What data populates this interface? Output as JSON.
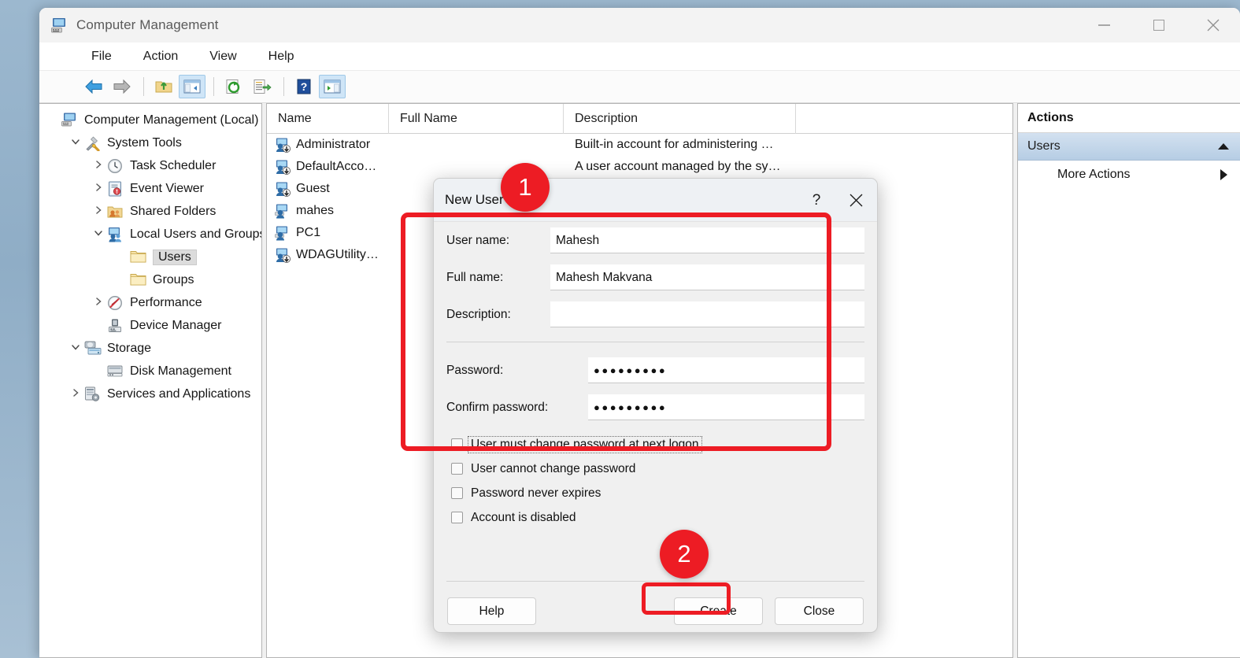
{
  "window": {
    "title": "Computer Management",
    "icon": "computer-management-icon",
    "controls": {
      "minimize": "–",
      "maximize": "□",
      "close": "✕"
    }
  },
  "menubar": {
    "items": [
      "File",
      "Action",
      "View",
      "Help"
    ]
  },
  "toolbar": {
    "buttons": [
      {
        "name": "back-icon",
        "label": "Back"
      },
      {
        "name": "forward-icon",
        "label": "Forward"
      },
      {
        "name": "up-one-level-icon",
        "label": "Up One Level"
      },
      {
        "name": "show-hide-console-tree-icon",
        "label": "Show/Hide Console Tree"
      },
      {
        "name": "refresh-icon",
        "label": "Refresh"
      },
      {
        "name": "export-list-icon",
        "label": "Export List"
      },
      {
        "name": "help-icon",
        "label": "Help"
      },
      {
        "name": "show-hide-action-pane-icon",
        "label": "Show/Hide Action Pane"
      }
    ]
  },
  "tree": {
    "nodes": [
      {
        "label": "Computer Management (Local)",
        "indent": 0,
        "chevron": "",
        "icon": "computer-icon",
        "selected": false
      },
      {
        "label": "System Tools",
        "indent": 1,
        "chevron": "expanded",
        "icon": "system-tools-icon",
        "selected": false
      },
      {
        "label": "Task Scheduler",
        "indent": 2,
        "chevron": "collapsed",
        "icon": "clock-icon",
        "selected": false
      },
      {
        "label": "Event Viewer",
        "indent": 2,
        "chevron": "collapsed",
        "icon": "event-viewer-icon",
        "selected": false
      },
      {
        "label": "Shared Folders",
        "indent": 2,
        "chevron": "collapsed",
        "icon": "shared-folders-icon",
        "selected": false
      },
      {
        "label": "Local Users and Groups",
        "indent": 2,
        "chevron": "expanded",
        "icon": "local-users-groups-icon",
        "selected": false
      },
      {
        "label": "Users",
        "indent": 3,
        "chevron": "",
        "icon": "folder-icon",
        "selected": true
      },
      {
        "label": "Groups",
        "indent": 3,
        "chevron": "",
        "icon": "folder-icon",
        "selected": false
      },
      {
        "label": "Performance",
        "indent": 2,
        "chevron": "collapsed",
        "icon": "performance-icon",
        "selected": false
      },
      {
        "label": "Device Manager",
        "indent": 2,
        "chevron": "",
        "icon": "device-manager-icon",
        "selected": false
      },
      {
        "label": "Storage",
        "indent": 1,
        "chevron": "expanded",
        "icon": "storage-icon",
        "selected": false
      },
      {
        "label": "Disk Management",
        "indent": 2,
        "chevron": "",
        "icon": "disk-management-icon",
        "selected": false
      },
      {
        "label": "Services and Applications",
        "indent": 1,
        "chevron": "collapsed",
        "icon": "services-icon",
        "selected": false
      }
    ]
  },
  "list": {
    "columns": [
      "Name",
      "Full Name",
      "Description",
      ""
    ],
    "rows": [
      {
        "name": "Administrator",
        "full_name": "",
        "description": "Built-in account for administering …",
        "icon": "user-disabled-icon"
      },
      {
        "name": "DefaultAcco…",
        "full_name": "",
        "description": "A user account managed by the sy…",
        "icon": "user-disabled-icon"
      },
      {
        "name": "Guest",
        "full_name": "",
        "description": "",
        "icon": "user-disabled-icon"
      },
      {
        "name": "mahes",
        "full_name": "",
        "description": "",
        "icon": "user-icon"
      },
      {
        "name": "PC1",
        "full_name": "",
        "description": "",
        "icon": "user-icon"
      },
      {
        "name": "WDAGUtility…",
        "full_name": "",
        "description": "",
        "icon": "user-disabled-icon"
      }
    ]
  },
  "actions": {
    "title": "Actions",
    "group_label": "Users",
    "group_toggle_icon": "caret-up-icon",
    "items": [
      {
        "label": "More Actions",
        "icon": "caret-right-icon"
      }
    ]
  },
  "dialog": {
    "title": "New User",
    "help_button": "?",
    "close_button": "✕",
    "fields": [
      {
        "label": "User name:",
        "value": "Mahesh",
        "placeholder": "",
        "name": "user-name-field"
      },
      {
        "label": "Full name:",
        "value": "Mahesh Makvana",
        "placeholder": "",
        "name": "full-name-field"
      },
      {
        "label": "Description:",
        "value": "",
        "placeholder": "",
        "name": "description-field"
      }
    ],
    "password_fields": [
      {
        "label": "Password:",
        "value": "●●●●●●●●●",
        "name": "password-field"
      },
      {
        "label": "Confirm password:",
        "value": "●●●●●●●●●",
        "name": "confirm-password-field"
      }
    ],
    "checkboxes": [
      {
        "label": "User must change password at next logon",
        "checked": false,
        "focused": true,
        "name": "must-change-password-checkbox"
      },
      {
        "label": "User cannot change password",
        "checked": false,
        "focused": false,
        "name": "cannot-change-password-checkbox"
      },
      {
        "label": "Password never expires",
        "checked": false,
        "focused": false,
        "name": "password-never-expires-checkbox"
      },
      {
        "label": "Account is disabled",
        "checked": false,
        "focused": false,
        "name": "account-disabled-checkbox"
      }
    ],
    "buttons": {
      "help": "Help",
      "create": "Create",
      "close": "Close"
    }
  },
  "annotations": {
    "accent_color": "#ed1c24",
    "markers": [
      {
        "number": "1",
        "target": "new-user-form-fields"
      },
      {
        "number": "2",
        "target": "create-button"
      }
    ]
  }
}
